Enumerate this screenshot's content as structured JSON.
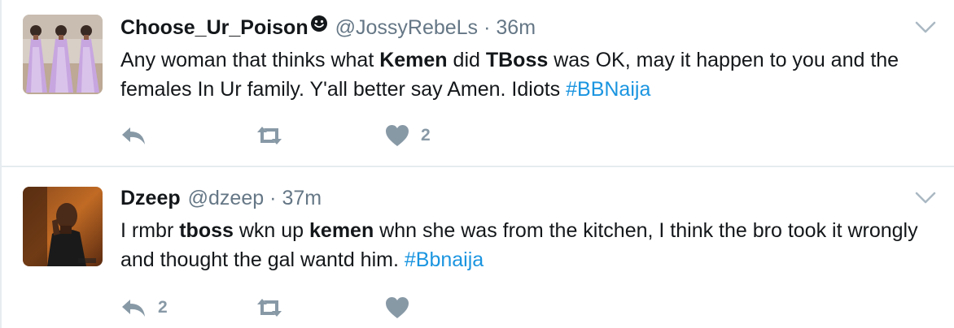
{
  "tweets": [
    {
      "fullname": "Choose_Ur_Poison",
      "username": "@JossyRebeLs",
      "separator": "·",
      "time": "36m",
      "text": {
        "p1": "Any woman that thinks what ",
        "b1": "Kemen",
        "p2": " did ",
        "b2": "TBoss",
        "p3": " was OK, may it happen to you and the females In Ur family. Y'all better say Amen. Idiots ",
        "hashtag": "#BBNaija"
      },
      "reply_count": "",
      "retweet_count": "",
      "like_count": "2"
    },
    {
      "fullname": "Dzeep",
      "username": "@dzeep",
      "separator": "·",
      "time": "37m",
      "text": {
        "p1": "I rmbr ",
        "b1": "tboss",
        "p2": " wkn up ",
        "b2": "kemen",
        "p3": " whn she was from the kitchen, I think the bro took it wrongly and thought the gal wantd him. ",
        "hashtag": "#Bbnaija"
      },
      "reply_count": "2",
      "retweet_count": "",
      "like_count": ""
    }
  ],
  "colors": {
    "text": "#14171a",
    "muted": "#657786",
    "icon": "#8899a6",
    "link": "#1b95e0",
    "divider": "#e6ecf0"
  },
  "icons": {
    "reply": "reply-icon",
    "retweet": "retweet-icon",
    "like": "heart-icon",
    "caret": "chevron-down-icon"
  }
}
